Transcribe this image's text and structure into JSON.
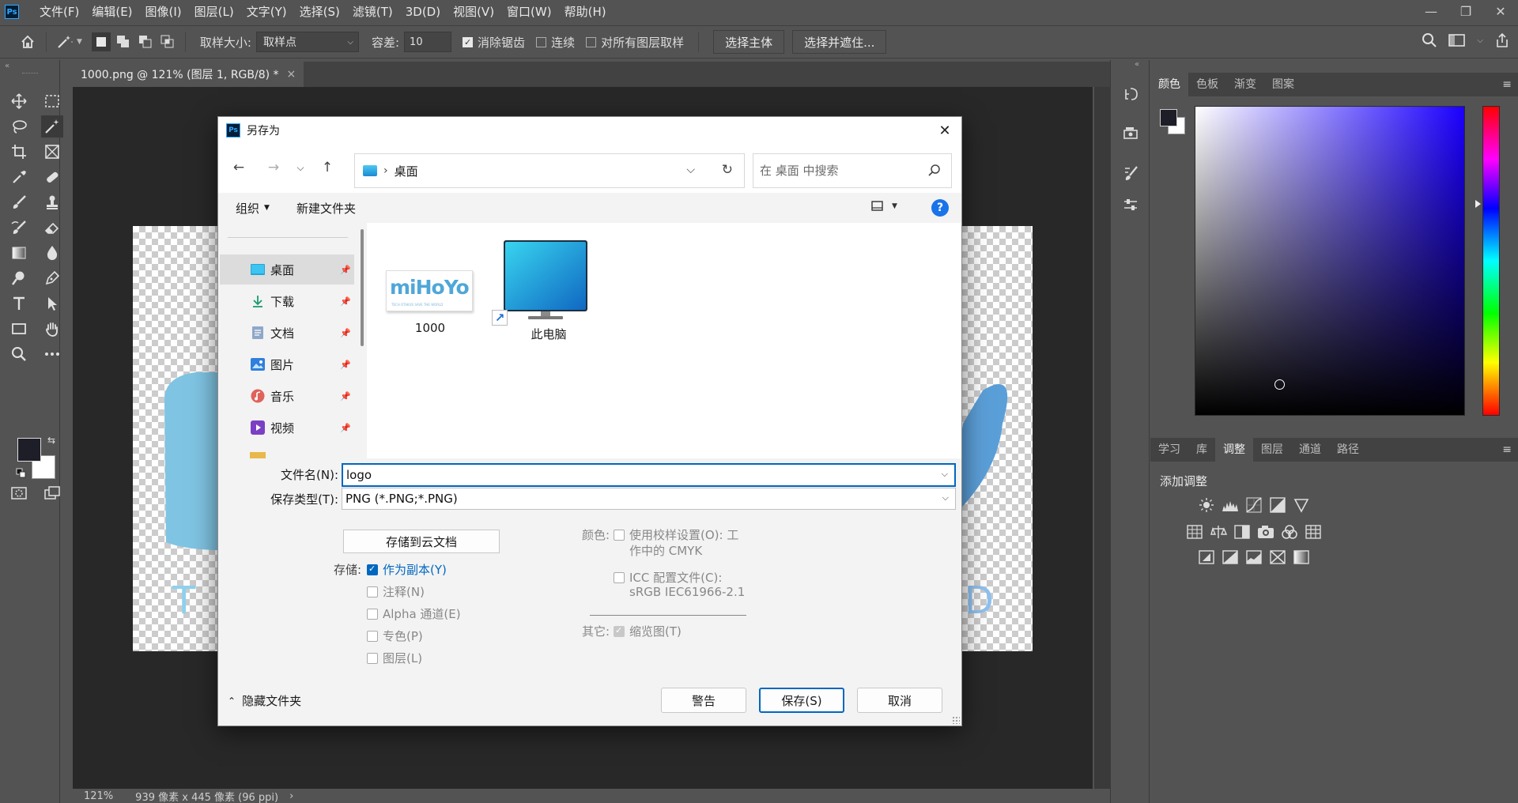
{
  "menu": [
    "文件(F)",
    "编辑(E)",
    "图像(I)",
    "图层(L)",
    "文字(Y)",
    "选择(S)",
    "滤镜(T)",
    "3D(D)",
    "视图(V)",
    "窗口(W)",
    "帮助(H)"
  ],
  "app_logo": "Ps",
  "options_bar": {
    "sample_size_label": "取样大小:",
    "sample_size_value": "取样点",
    "tolerance_label": "容差:",
    "tolerance_value": "10",
    "antialias_label": "消除锯齿",
    "contiguous_label": "连续",
    "all_layers_label": "对所有图层取样",
    "select_subject_label": "选择主体",
    "select_mask_label": "选择并遮住..."
  },
  "document_tab": {
    "title": "1000.png @ 121% (图层 1, RGB/8) *",
    "close": "×"
  },
  "status": {
    "zoom": "121%",
    "doc_size": "939 像素 x 445 像素 (96 ppi)",
    "arrow": "›"
  },
  "right_panel": {
    "top_tabs": [
      "颜色",
      "色板",
      "渐变",
      "图案"
    ],
    "bottom_tabs": [
      "学习",
      "库",
      "调整",
      "图层",
      "通道",
      "路径"
    ],
    "add_adjustment_label": "添加调整"
  },
  "dialog": {
    "ps_icon": "Ps",
    "title": "另存为",
    "close": "✕",
    "breadcrumb": "桌面",
    "search_placeholder": "在 桌面 中搜索",
    "organize_label": "组织",
    "new_folder_label": "新建文件夹",
    "help": "?",
    "nav_items": [
      {
        "label": "桌面",
        "icon": "desktop-icon"
      },
      {
        "label": "下载",
        "icon": "download-icon"
      },
      {
        "label": "文档",
        "icon": "document-icon"
      },
      {
        "label": "图片",
        "icon": "picture-icon"
      },
      {
        "label": "音乐",
        "icon": "music-icon"
      },
      {
        "label": "视频",
        "icon": "video-icon"
      }
    ],
    "files": [
      {
        "label": "1000",
        "thumb_text": "miHoYo",
        "thumb_sub": "TECH OTAKUS SAVE THE WORLD"
      },
      {
        "label": "此电脑"
      }
    ],
    "filename_label": "文件名(N):",
    "filename_value": "logo",
    "filetype_label": "保存类型(T):",
    "filetype_value": "PNG (*.PNG;*.PNG)",
    "cloud_button": "存储到云文档",
    "save_label": "存储:",
    "save_options": [
      {
        "label": "作为副本(Y)",
        "checked": true
      },
      {
        "label": "注释(N)",
        "checked": false
      },
      {
        "label": "Alpha 通道(E)",
        "checked": false
      },
      {
        "label": "专色(P)",
        "checked": false
      },
      {
        "label": "图层(L)",
        "checked": false
      }
    ],
    "color_label": "颜色:",
    "proof_line1": "使用校样设置(O): 工",
    "proof_line2": "作中的 CMYK",
    "icc_line1": "ICC 配置文件(C):",
    "icc_line2": "sRGB IEC61966-2.1",
    "other_label": "其它:",
    "thumbnail_label": "缩览图(T)",
    "hide_folders": "隐藏文件夹",
    "warning_button": "警告",
    "save_button": "保存(S)",
    "cancel_button": "取消"
  },
  "colors": {
    "accent": "#0067c0",
    "ps_bg": "#535353",
    "canvas_bg": "#282828",
    "foreground": "#1e1e28"
  }
}
